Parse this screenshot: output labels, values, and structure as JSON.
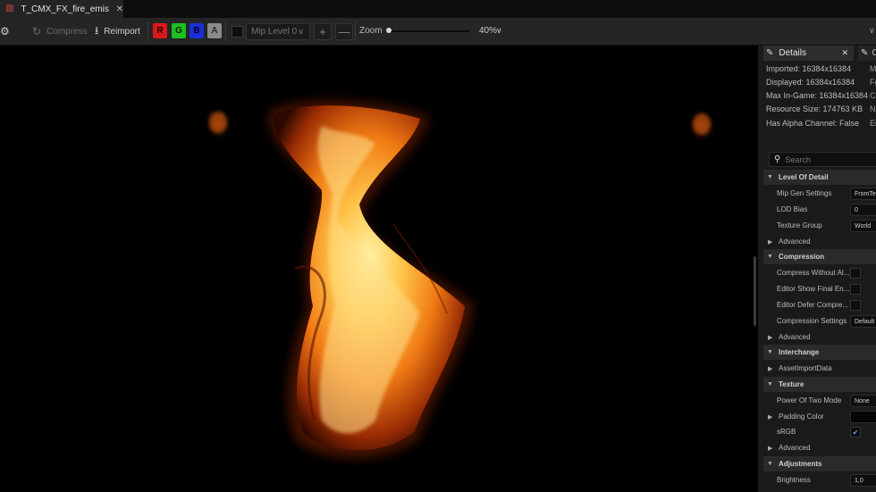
{
  "window": {
    "tab_title": "T_CMX_FX_fire_emissiv...",
    "tab_icon": "texture-icon"
  },
  "toolbar": {
    "compress_label": "Compress",
    "reimport_label": "Reimport",
    "channels": [
      "R",
      "G",
      "B",
      "A"
    ],
    "mip_level": "Mip Level 0",
    "zoom_label": "Zoom",
    "zoom_value": "40%",
    "zoom_fraction": 0.02,
    "plus": "+",
    "minus": "—"
  },
  "details": {
    "tab_label": "Details",
    "tab2_label": "C",
    "info_left": [
      "Imported: 16384x16384",
      "Displayed: 16384x16384",
      "Max In-Game: 16384x16384",
      "Resource Size: 174763 KB",
      "Has Alpha Channel: False"
    ],
    "info_right": [
      "M",
      "Fo",
      "Co",
      "Nu",
      "En"
    ],
    "search_placeholder": "Search",
    "rows": {
      "lod": "Level Of Detail",
      "mip_gen": "Mip Gen Settings",
      "mip_gen_val": "FromTe",
      "lod_bias": "LOD Bias",
      "lod_bias_val": "0",
      "texture_group": "Texture Group",
      "texture_group_val": "World",
      "advanced": "Advanced",
      "compression": "Compression",
      "compress_wo_alpha": "Compress Without Al...",
      "editor_show_final": "Editor Show Final En...",
      "editor_defer": "Editor Defer Compre...",
      "compression_settings": "Compression Settings",
      "compression_settings_val": "Default",
      "interchange": "Interchange",
      "asset_import": "AssetImportData",
      "texture": "Texture",
      "power_of_two": "Power Of Two Mode",
      "power_of_two_val": "None",
      "padding_color": "Padding Color",
      "srgb": "sRGB",
      "adjustments": "Adjustments",
      "brightness": "Brightness",
      "brightness_val": "1,0"
    }
  },
  "colors": {
    "channel_r": "#d81818",
    "channel_g": "#1fbf1f",
    "channel_b": "#1a2fd8",
    "channel_a": "#8a8a8a",
    "panel_bg": "#1a1a1a",
    "viewport_bg": "#000000"
  }
}
